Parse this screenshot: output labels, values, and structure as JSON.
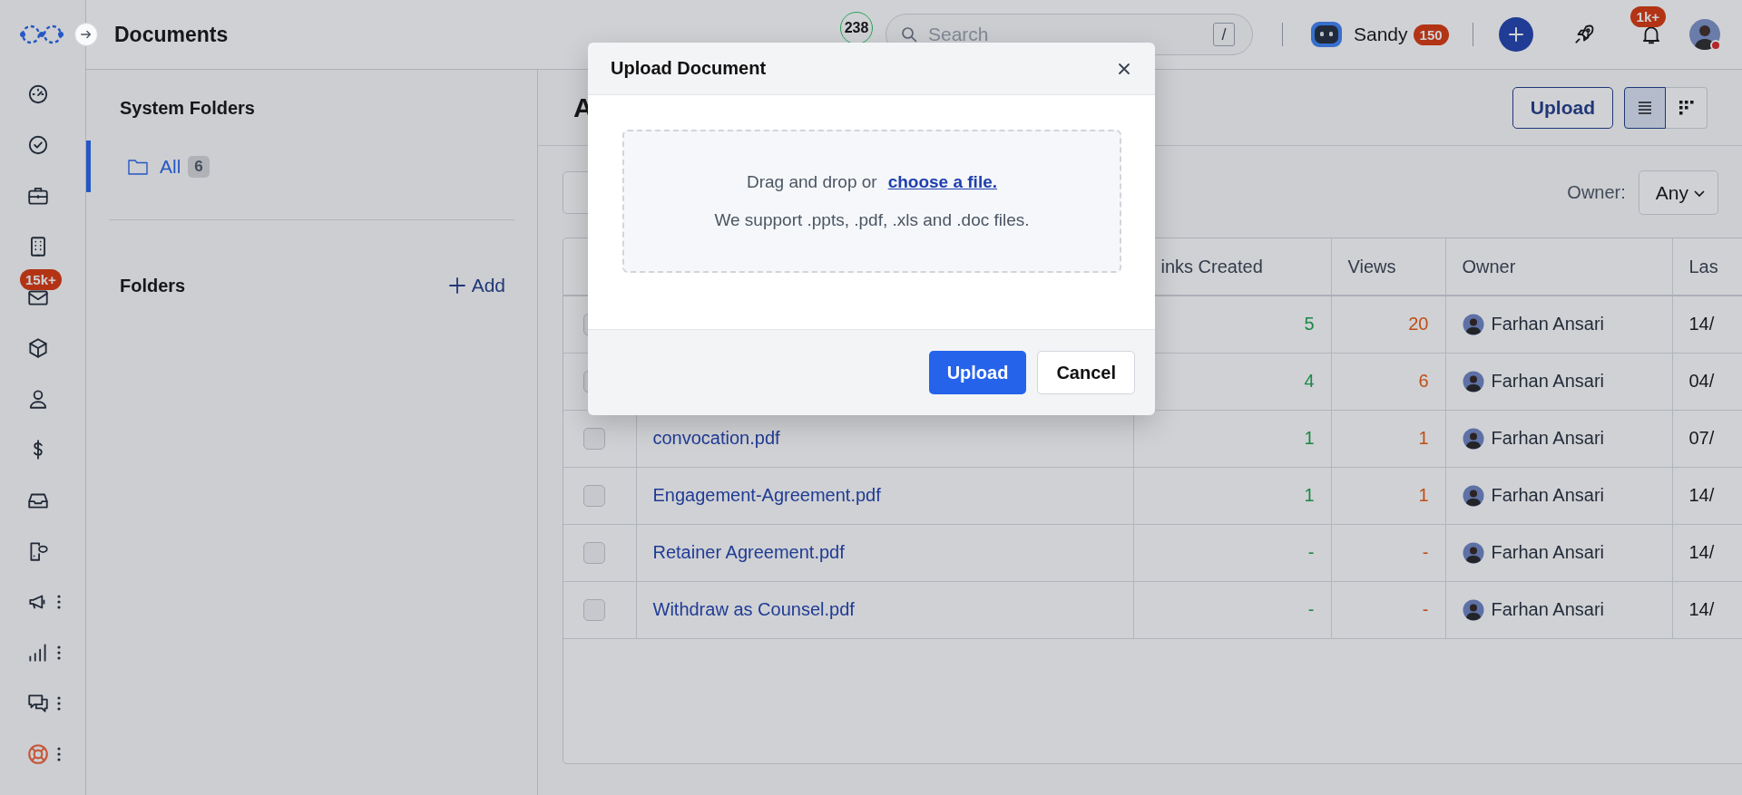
{
  "top_bar": {
    "title": "Documents",
    "counter": "238",
    "search": {
      "placeholder": "Search",
      "shortcut": "/"
    },
    "user": {
      "name": "Sandy",
      "badge": "150"
    },
    "notifications_badge": "1k+"
  },
  "nav_rail": {
    "items": [
      {
        "kind": "link"
      },
      {
        "kind": "link"
      },
      {
        "kind": "link"
      },
      {
        "kind": "link"
      },
      {
        "kind": "link",
        "badge": "15k+"
      },
      {
        "kind": "link"
      },
      {
        "kind": "link"
      },
      {
        "kind": "link"
      },
      {
        "kind": "link"
      },
      {
        "kind": "link"
      },
      {
        "kind": "menu"
      },
      {
        "kind": "menu"
      },
      {
        "kind": "menu"
      },
      {
        "kind": "menu"
      }
    ]
  },
  "folders_panel": {
    "system_heading": "System Folders",
    "system_folders": [
      {
        "label": "All",
        "count": "6",
        "selected": true
      }
    ],
    "folders_heading": "Folders",
    "add_label": "Add"
  },
  "main": {
    "heading": "A",
    "upload_label": "Upload",
    "views": [
      {
        "selected": true
      },
      {
        "selected": false
      }
    ],
    "owner_filter": {
      "label": "Owner:",
      "value": "Any"
    },
    "table": {
      "columns": [
        "inks Created",
        "Views",
        "Owner",
        "Las"
      ],
      "rows": [
        {
          "checked": false,
          "links_created": "5",
          "views": "20",
          "owner": "Farhan Ansari",
          "column_6": "14/"
        },
        {
          "checked": false,
          "links_created": "4",
          "views": "6",
          "owner": "Farhan Ansari",
          "column_6": "04/"
        },
        {
          "checked": false,
          "name": "convocation.pdf",
          "links_created": "1",
          "views": "1",
          "owner": "Farhan Ansari",
          "column_6": "07/"
        },
        {
          "checked": false,
          "name": "Engagement-Agreement.pdf",
          "links_created": "1",
          "views": "1",
          "owner": "Farhan Ansari",
          "column_6": "14/"
        },
        {
          "checked": false,
          "name": "Retainer Agreement.pdf",
          "links_created": "-",
          "views": "-",
          "owner": "Farhan Ansari",
          "column_6": "14/"
        },
        {
          "checked": false,
          "name": "Withdraw as Counsel.pdf",
          "links_created": "-",
          "views": "-",
          "owner": "Farhan Ansari",
          "column_6": "14/"
        }
      ]
    }
  },
  "modal": {
    "title": "Upload Document",
    "drop_text": "Drag and drop or",
    "link": "choose a file.",
    "support_text": "We support .ppts, .pdf, .xls and .doc files.",
    "buttons": [
      {
        "label": "Upload",
        "kind": "primary"
      },
      {
        "label": "Cancel",
        "kind": "secondary"
      }
    ]
  }
}
